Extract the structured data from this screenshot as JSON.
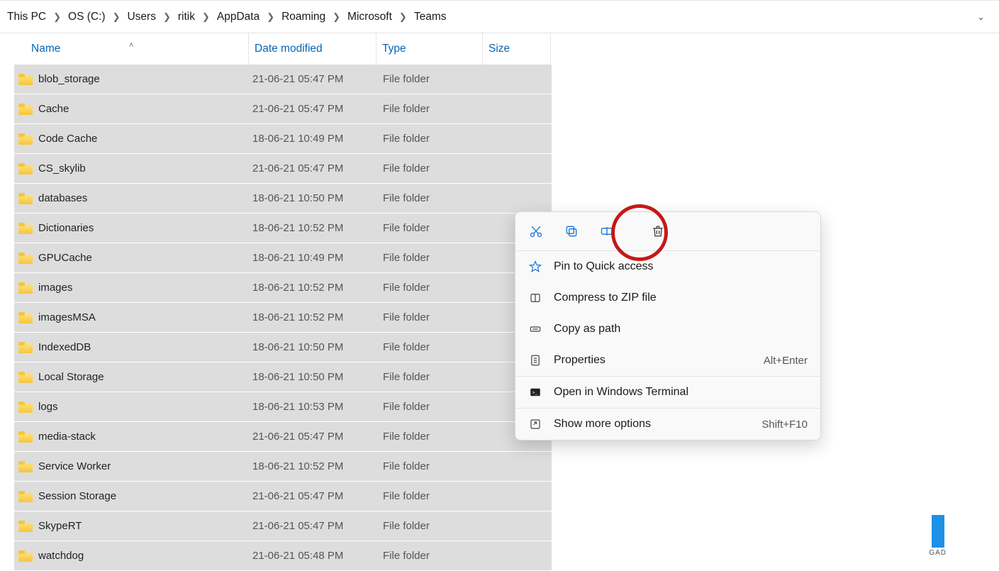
{
  "breadcrumb": [
    "This PC",
    "OS (C:)",
    "Users",
    "ritik",
    "AppData",
    "Roaming",
    "Microsoft",
    "Teams"
  ],
  "columns": {
    "name": "Name",
    "date": "Date modified",
    "type": "Type",
    "size": "Size"
  },
  "rows": [
    {
      "name": "blob_storage",
      "date": "21-06-21 05:47 PM",
      "type": "File folder"
    },
    {
      "name": "Cache",
      "date": "21-06-21 05:47 PM",
      "type": "File folder"
    },
    {
      "name": "Code Cache",
      "date": "18-06-21 10:49 PM",
      "type": "File folder"
    },
    {
      "name": "CS_skylib",
      "date": "21-06-21 05:47 PM",
      "type": "File folder"
    },
    {
      "name": "databases",
      "date": "18-06-21 10:50 PM",
      "type": "File folder"
    },
    {
      "name": "Dictionaries",
      "date": "18-06-21 10:52 PM",
      "type": "File folder"
    },
    {
      "name": "GPUCache",
      "date": "18-06-21 10:49 PM",
      "type": "File folder"
    },
    {
      "name": "images",
      "date": "18-06-21 10:52 PM",
      "type": "File folder"
    },
    {
      "name": "imagesMSA",
      "date": "18-06-21 10:52 PM",
      "type": "File folder"
    },
    {
      "name": "IndexedDB",
      "date": "18-06-21 10:50 PM",
      "type": "File folder"
    },
    {
      "name": "Local Storage",
      "date": "18-06-21 10:50 PM",
      "type": "File folder"
    },
    {
      "name": "logs",
      "date": "18-06-21 10:53 PM",
      "type": "File folder"
    },
    {
      "name": "media-stack",
      "date": "21-06-21 05:47 PM",
      "type": "File folder"
    },
    {
      "name": "Service Worker",
      "date": "18-06-21 10:52 PM",
      "type": "File folder"
    },
    {
      "name": "Session Storage",
      "date": "21-06-21 05:47 PM",
      "type": "File folder"
    },
    {
      "name": "SkypeRT",
      "date": "21-06-21 05:47 PM",
      "type": "File folder"
    },
    {
      "name": "watchdog",
      "date": "21-06-21 05:48 PM",
      "type": "File folder"
    }
  ],
  "context_menu": {
    "pin": "Pin to Quick access",
    "compress": "Compress to ZIP file",
    "copypath": "Copy as path",
    "properties": "Properties",
    "properties_shortcut": "Alt+Enter",
    "terminal": "Open in Windows Terminal",
    "more": "Show more options",
    "more_shortcut": "Shift+F10"
  },
  "watermark": "GAD"
}
